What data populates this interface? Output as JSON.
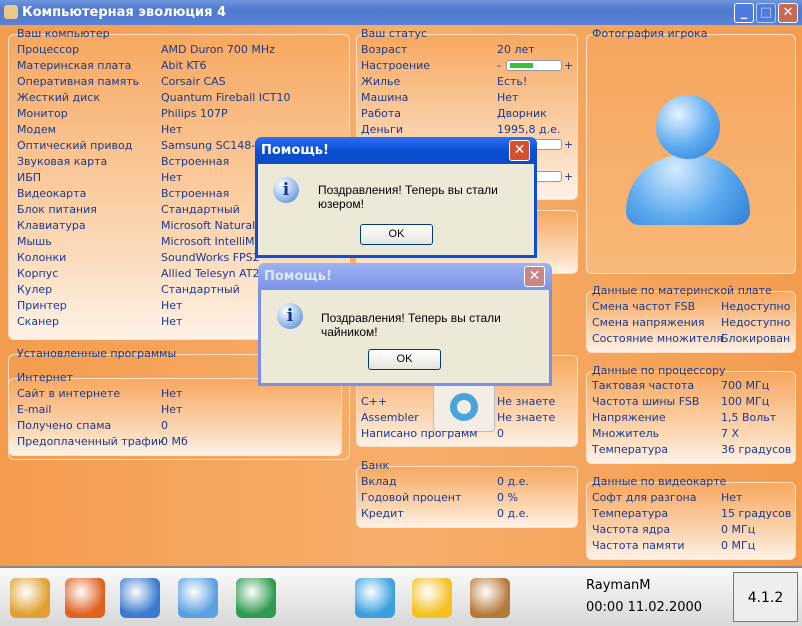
{
  "window": {
    "title": "Компьютерная эволюция 4",
    "minimize": "_",
    "maximize": "□",
    "close": "✕"
  },
  "computer": {
    "title": "Ваш компьютер",
    "rows": [
      [
        "Процессор",
        "AMD Duron 700 MHz"
      ],
      [
        "Материнская плата",
        "Abit KT6"
      ],
      [
        "Оперативная память",
        "Corsair CAS"
      ],
      [
        "Жесткий диск",
        "Quantum Fireball ICT10"
      ],
      [
        "Монитор",
        "Philips 107P"
      ],
      [
        "Модем",
        "Нет"
      ],
      [
        "Оптический привод",
        "Samsung SC148-F"
      ],
      [
        "Звуковая карта",
        "Встроенная"
      ],
      [
        "ИБП",
        "Нет"
      ],
      [
        "Видеокарта",
        "Встроенная"
      ],
      [
        "Блок питания",
        "Стандартный"
      ],
      [
        "Клавиатура",
        "Microsoft Natural"
      ],
      [
        "Мышь",
        "Microsoft IntelliM"
      ],
      [
        "Колонки",
        "SoundWorks FPS2"
      ],
      [
        "Корпус",
        "Allied Telesyn AT2"
      ],
      [
        "Кулер",
        "Стандартный"
      ],
      [
        "Принтер",
        "Нет"
      ],
      [
        "Сканер",
        "Нет"
      ]
    ]
  },
  "programs": {
    "title": "Установленные программы",
    "internet": {
      "title": "Интернет",
      "rows": [
        [
          "Сайт в интернете",
          "Нет"
        ],
        [
          "E-mail",
          "Нет"
        ],
        [
          "Получено спама",
          "0"
        ],
        [
          "Предоплаченный трафик",
          "0 Мб"
        ]
      ]
    }
  },
  "status": {
    "title": "Ваш статус",
    "rows": [
      [
        "Возраст",
        "20 лет"
      ],
      [
        "Настроение",
        ""
      ],
      [
        "Жилье",
        "Есть!"
      ],
      [
        "Машина",
        "Нет"
      ],
      [
        "Работа",
        "Дворник"
      ],
      [
        "Деньги",
        "1995,8 д.е."
      ]
    ],
    "mood_level": 0.45,
    "minus": "-",
    "plus": "+"
  },
  "skills": {
    "rows": [
      [
        "C++",
        "Не знаете"
      ],
      [
        "Assembler",
        "Не знаете"
      ],
      [
        "Написано программ",
        "0"
      ]
    ]
  },
  "bank": {
    "title": "Банк",
    "rows": [
      [
        "Вклад",
        "0 д.е."
      ],
      [
        "Годовой процент",
        "0 %"
      ],
      [
        "Кредит",
        "0 д.е."
      ]
    ]
  },
  "photo": {
    "title": "Фотография игрока"
  },
  "motherboard": {
    "title": "Данные по материнской плате",
    "rows": [
      [
        "Смена частот FSB",
        "Недоступно"
      ],
      [
        "Смена напряжения",
        "Недоступно"
      ],
      [
        "Состояние множителя",
        "Блокирован"
      ]
    ]
  },
  "cpu": {
    "title": "Данные по процессору",
    "rows": [
      [
        "Тактовая частота",
        "700 МГц"
      ],
      [
        "Частота шины FSB",
        "100 МГц"
      ],
      [
        "Напряжение",
        "1,5 Вольт"
      ],
      [
        "Множитель",
        "7 X"
      ],
      [
        "Температура",
        "36 градусов"
      ]
    ]
  },
  "gpu": {
    "title": "Данные по видеокарте",
    "rows": [
      [
        "Софт для разгона",
        "Нет"
      ],
      [
        "Температура",
        "15 градусов"
      ],
      [
        "Частота ядра",
        "0 МГц"
      ],
      [
        "Частота памяти",
        "0 МГц"
      ]
    ]
  },
  "dialogs": [
    {
      "title": "Помощь!",
      "message": "Поздравления! Теперь вы стали юзером!",
      "ok": "OK",
      "close": "✕"
    },
    {
      "title": "Помощь!",
      "message": "Поздравления! Теперь вы стали чайником!",
      "ok": "OK",
      "close": "✕"
    }
  ],
  "taskbar": {
    "icons": [
      "kde-gear-icon",
      "home-icon",
      "computer-icon",
      "install-software-icon",
      "hardware-info-icon",
      "blocks-icon",
      "star-icon",
      "wallet-icon"
    ],
    "user": "RaymanM",
    "datetime": "00:00 11.02.2000",
    "version": "4.1.2"
  }
}
